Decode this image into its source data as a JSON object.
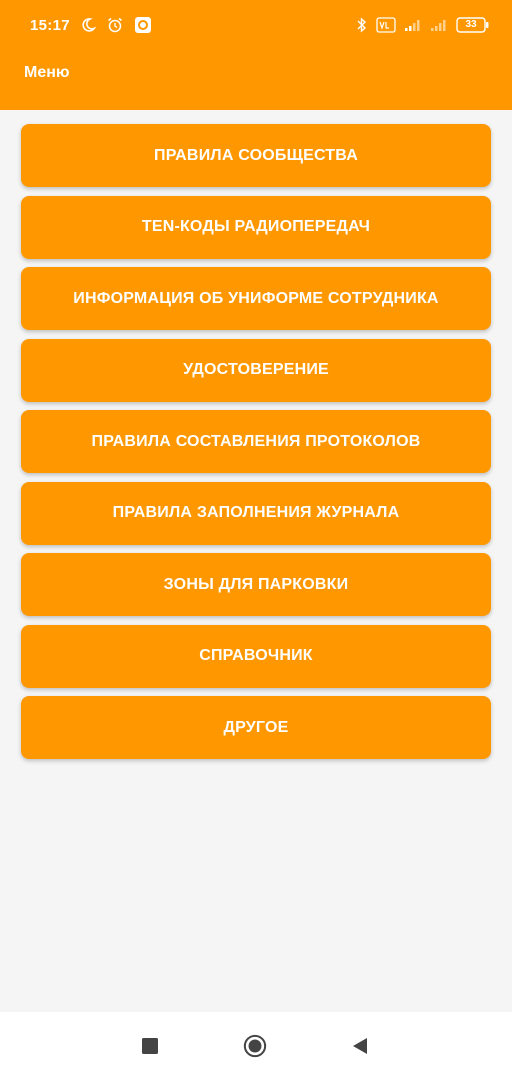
{
  "status_bar": {
    "time": "15:17",
    "battery": "33",
    "icons": [
      "moon-icon",
      "alarm-icon",
      "screen-record-icon",
      "bluetooth-icon",
      "volte-icon",
      "signal-icon",
      "signal-icon",
      "battery-icon"
    ]
  },
  "app_bar": {
    "title": "Меню",
    "color": "#ff9800"
  },
  "menu": {
    "items": [
      {
        "label": "ПРАВИЛА СООБЩЕСТВА"
      },
      {
        "label": "TEN-КОДЫ РАДИОПЕРЕДАЧ"
      },
      {
        "label": "ИНФОРМАЦИЯ ОБ УНИФОРМЕ СОТРУДНИКА"
      },
      {
        "label": "УДОСТОВЕРЕНИЕ"
      },
      {
        "label": "ПРАВИЛА СОСТАВЛЕНИЯ ПРОТОКОЛОВ"
      },
      {
        "label": "ПРАВИЛА ЗАПОЛНЕНИЯ ЖУРНАЛА"
      },
      {
        "label": "ЗОНЫ ДЛЯ ПАРКОВКИ"
      },
      {
        "label": "СПРАВОЧНИК"
      },
      {
        "label": "ДРУГОЕ"
      }
    ]
  },
  "nav_bar": {
    "icons": [
      "recents-square-icon",
      "home-circle-icon",
      "back-triangle-icon"
    ]
  }
}
